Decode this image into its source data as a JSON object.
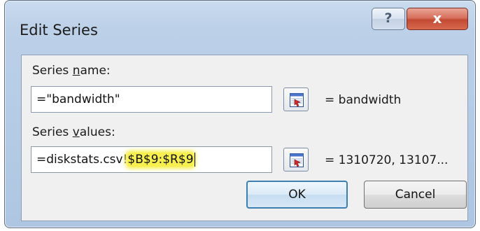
{
  "window": {
    "title": "Edit Series",
    "help_label": "?",
    "close_label": "x"
  },
  "series_name": {
    "label_pre": "Series ",
    "label_accel": "n",
    "label_post": "ame:",
    "value": "=\"bandwidth\"",
    "result": "= bandwidth"
  },
  "series_values": {
    "label_pre": "Series ",
    "label_accel": "v",
    "label_post": "alues:",
    "value_prefix": "=diskstats.csv!",
    "value_highlighted": "$B$9:$R$9",
    "result": "= 1310720, 13107..."
  },
  "buttons": {
    "ok": "OK",
    "cancel": "Cancel"
  },
  "colors": {
    "highlight": "#f7ef4e",
    "close_button": "#c24a33",
    "title_bar": "#bcd0e8"
  },
  "icons": {
    "range_picker": "collapse-dialog-icon"
  }
}
